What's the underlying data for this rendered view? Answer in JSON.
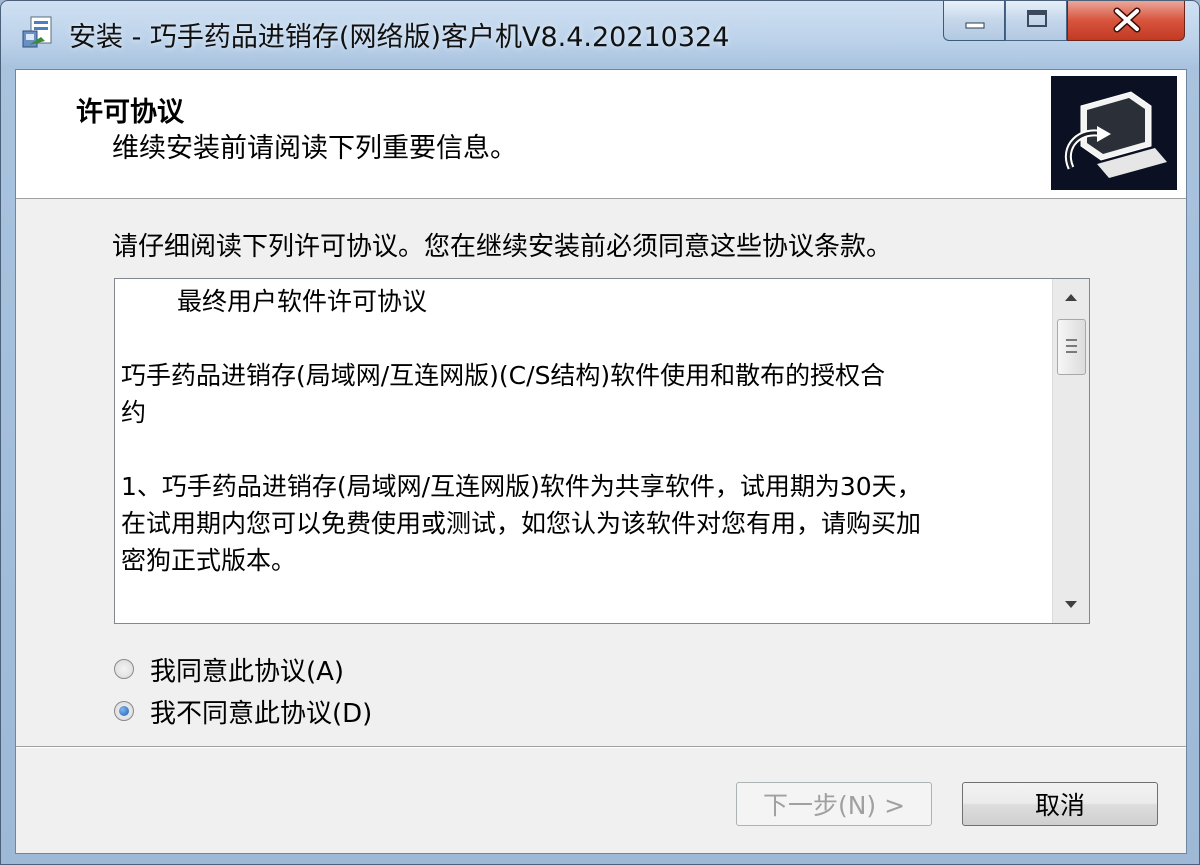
{
  "window": {
    "title": "安装 - 巧手药品进销存(网络版)客户机V8.4.20210324"
  },
  "header": {
    "title": "许可协议",
    "subtitle": "维续安装前请阅读下列重要信息。"
  },
  "instruction": "请仔细阅读下列许可协议。您在继续安装前必须同意这些协议条款。",
  "license": {
    "title": "最终用户软件许可协议",
    "paragraph1_line1": "巧手药品进销存(局域网/互连网版)(C/S结构)软件使用和散布的授权合",
    "paragraph1_line2": "约",
    "paragraph2_line1": "1、巧手药品进销存(局域网/互连网版)软件为共享软件，试用期为30天，",
    "paragraph2_line2": "在试用期内您可以免费使用或测试，如您认为该软件对您有用，请购买加",
    "paragraph2_line3": "密狗正式版本。"
  },
  "options": {
    "agree": {
      "label": "我同意此协议(A)",
      "selected": false
    },
    "disagree": {
      "label": "我不同意此协议(D)",
      "selected": true
    }
  },
  "buttons": {
    "next": "下一步(N) >",
    "cancel": "取消"
  },
  "colors": {
    "title_bar": "#bcd2ea",
    "close_button": "#d8543d",
    "client_bg": "#f0f0f0",
    "logo_bg": "#0b1122"
  },
  "icons": {
    "app": "installer-icon",
    "logo": "computer-install-logo"
  }
}
